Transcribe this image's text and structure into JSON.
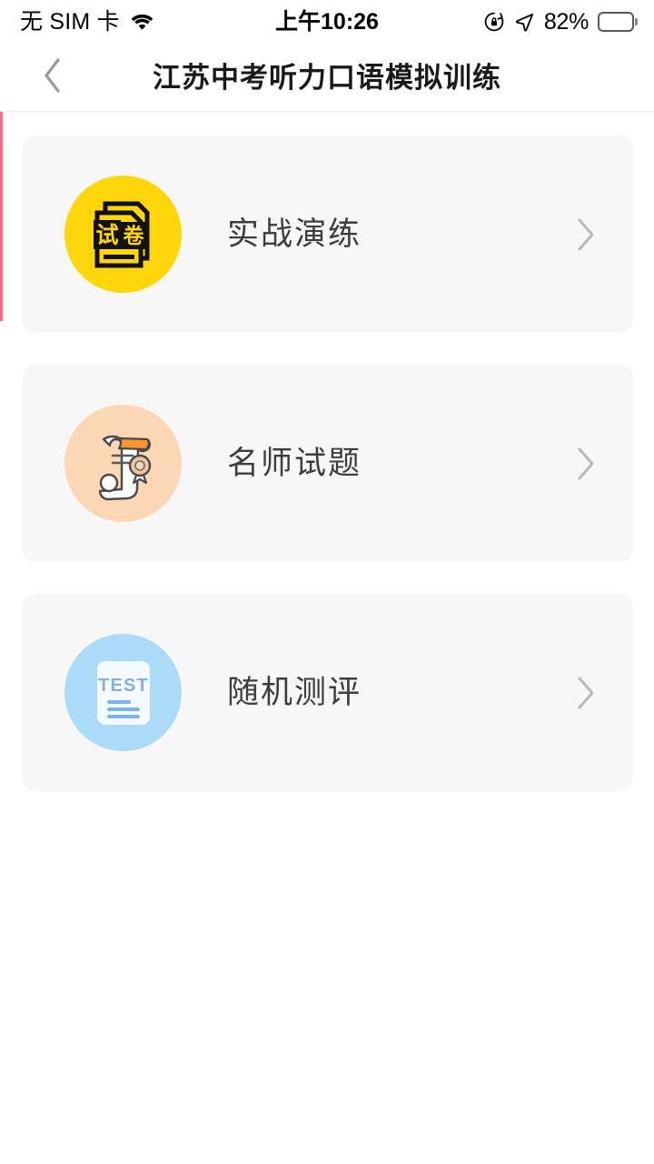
{
  "status_bar": {
    "carrier": "无 SIM 卡",
    "wifi_icon": "wifi-icon",
    "time": "上午10:26",
    "rotation_lock_icon": "rotation-lock-icon",
    "location_icon": "location-arrow-icon",
    "battery_percent": "82%",
    "battery_icon": "battery-full-icon"
  },
  "nav": {
    "back_icon": "chevron-left-icon",
    "title": "江苏中考听力口语模拟训练"
  },
  "theme": {
    "page_bg": "#ffffff",
    "card_bg": "#f7f7f7",
    "label_color": "#3d3d3d",
    "rail_accent": "#fb6a80",
    "chevron_color": "#b8b8b8"
  },
  "menu": {
    "items": [
      {
        "label": "实战演练",
        "icon_name": "exam-paper-icon",
        "icon_text": "试卷",
        "icon_bg": "#ffd60a",
        "chevron_icon": "chevron-right-icon"
      },
      {
        "label": "名师试题",
        "icon_name": "scroll-certificate-icon",
        "icon_text": "",
        "icon_bg": "#fbd7b5",
        "chevron_icon": "chevron-right-icon"
      },
      {
        "label": "随机测评",
        "icon_name": "test-document-icon",
        "icon_text": "TEST",
        "icon_bg": "#abdcf7",
        "chevron_icon": "chevron-right-icon"
      }
    ]
  }
}
